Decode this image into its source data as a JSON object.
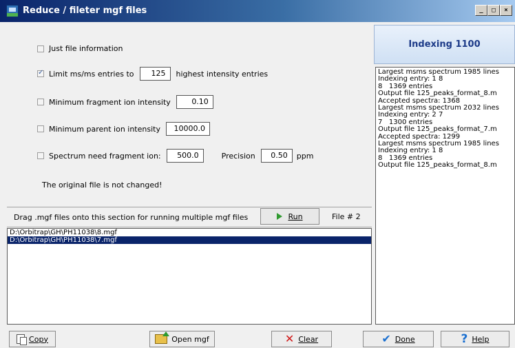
{
  "window": {
    "title": "Reduce / fileter mgf files",
    "controls": [
      "_",
      "□",
      "×"
    ]
  },
  "options": {
    "just_file_info": {
      "label": "Just file information",
      "checked": false
    },
    "limit_entries": {
      "label": "Limit ms/ms entries to",
      "value": "125",
      "suffix": "highest intensity entries",
      "checked": true
    },
    "min_fragment": {
      "label": "Minimum fragment ion intensity",
      "value": "0.10",
      "checked": false
    },
    "min_parent": {
      "label": "Minimum parent ion intensity",
      "value": "10000.0",
      "checked": false
    },
    "spectrum_fragment": {
      "label": "Spectrum need fragment ion:",
      "value": "500.0",
      "precision_label": "Precision",
      "precision_value": "0.50",
      "unit": "ppm",
      "checked": false
    },
    "note": "The original file is not changed!"
  },
  "drag": {
    "text": "Drag .mgf files onto this section for running multiple mgf files",
    "run_label": "Run",
    "file_count": "File # 2"
  },
  "files": [
    {
      "path": "D:\\Orbitrap\\GH\\PH11038\\8.mgf",
      "selected": false
    },
    {
      "path": "D:\\Orbitrap\\GH\\PH11038\\7.mgf",
      "selected": true
    }
  ],
  "status": {
    "heading": "Indexing 1100"
  },
  "log": [
    "Largest msms spectrum 1985 lines",
    "Indexing entry: 1 8",
    "8   1369 entries",
    "Output file 125_peaks_format_8.m",
    "Accepted spectra: 1368",
    "Largest msms spectrum 2032 lines",
    "Indexing entry: 2 7",
    "7   1300 entries",
    "Output file 125_peaks_format_7.m",
    "Accepted spectra: 1299",
    "Largest msms spectrum 1985 lines",
    "Indexing entry: 1 8",
    "8   1369 entries",
    "Output file 125_peaks_format_8.m"
  ],
  "buttons": {
    "copy": "Copy",
    "open": "Open mgf",
    "clear": "Clear",
    "done": "Done",
    "help": "Help"
  },
  "colors": {
    "title_bar": "#0a246a",
    "selection": "#0a246a",
    "heading_text": "#1c3a88"
  }
}
